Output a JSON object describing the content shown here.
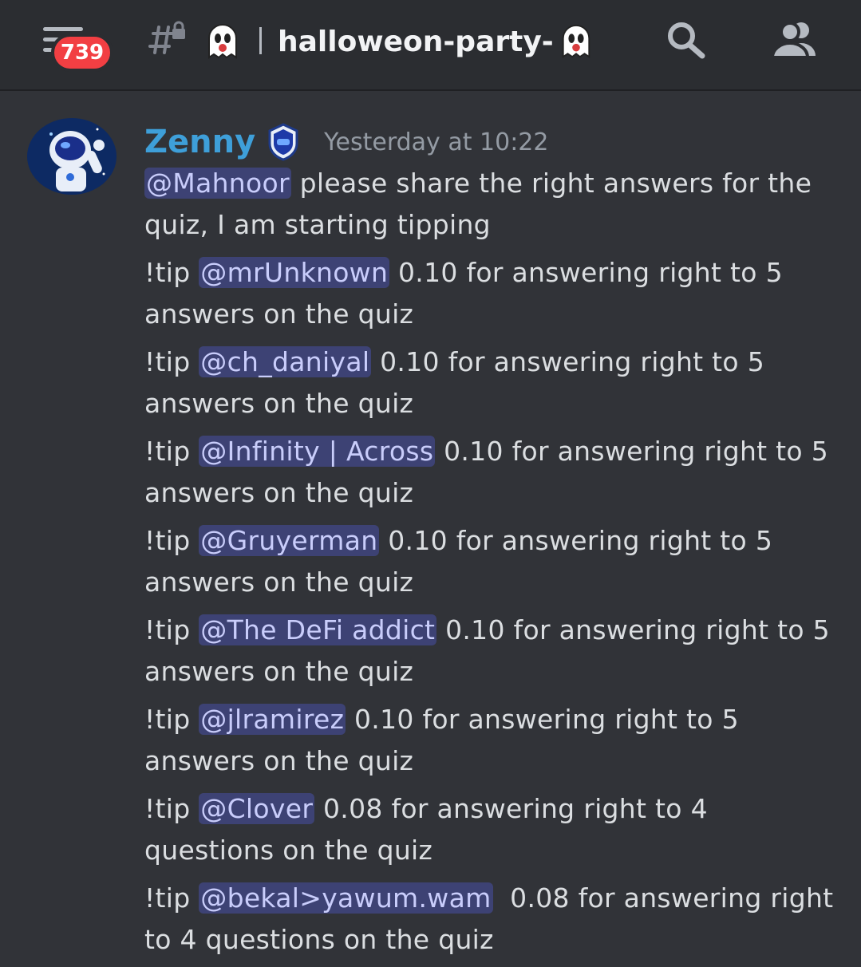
{
  "topbar": {
    "unread_count": "739",
    "channel_name": "halloweon-party-",
    "icons": {
      "menu": "hamburger-icon",
      "channel": "locked-thread-channel-icon",
      "channel_emoji": "ghost-emoji",
      "search": "search-icon",
      "members": "members-icon"
    }
  },
  "message": {
    "author": "Zenny",
    "timestamp": "Yesterday at 10:22",
    "lines": [
      {
        "prefix": "",
        "mention": "@Mahnoor",
        "text": " please share the right answers for the quiz, I am starting tipping"
      },
      {
        "prefix": "!tip ",
        "mention": "@mrUnknown",
        "text": " 0.10 for answering right to 5 answers on the quiz"
      },
      {
        "prefix": "!tip ",
        "mention": "@ch_daniyal",
        "text": " 0.10 for answering right to 5 answers on the quiz"
      },
      {
        "prefix": "!tip ",
        "mention": "@Infinity | Across",
        "text": " 0.10 for answering right to 5 answers on the quiz"
      },
      {
        "prefix": "!tip ",
        "mention": "@Gruyerman",
        "text": " 0.10 for answering right to 5 answers on the quiz"
      },
      {
        "prefix": "!tip ",
        "mention": "@The DeFi addict",
        "text": " 0.10 for answering right to 5 answers on the quiz"
      },
      {
        "prefix": "!tip ",
        "mention": "@jlramirez",
        "text": " 0.10 for answering right to 5 answers on the quiz"
      },
      {
        "prefix": "!tip ",
        "mention": "@Clover",
        "text": " 0.08 for answering right to 4 questions on the quiz"
      },
      {
        "prefix": "!tip ",
        "mention": "@bekal>yawum.wam",
        "text": "  0.08 for answering right to 4 questions on the quiz"
      }
    ]
  },
  "colors": {
    "background": "#313338",
    "topbar": "#2b2d31",
    "username": "#3e9fd9",
    "mention_text": "#c9cdfb",
    "badge": "#f23f43"
  }
}
